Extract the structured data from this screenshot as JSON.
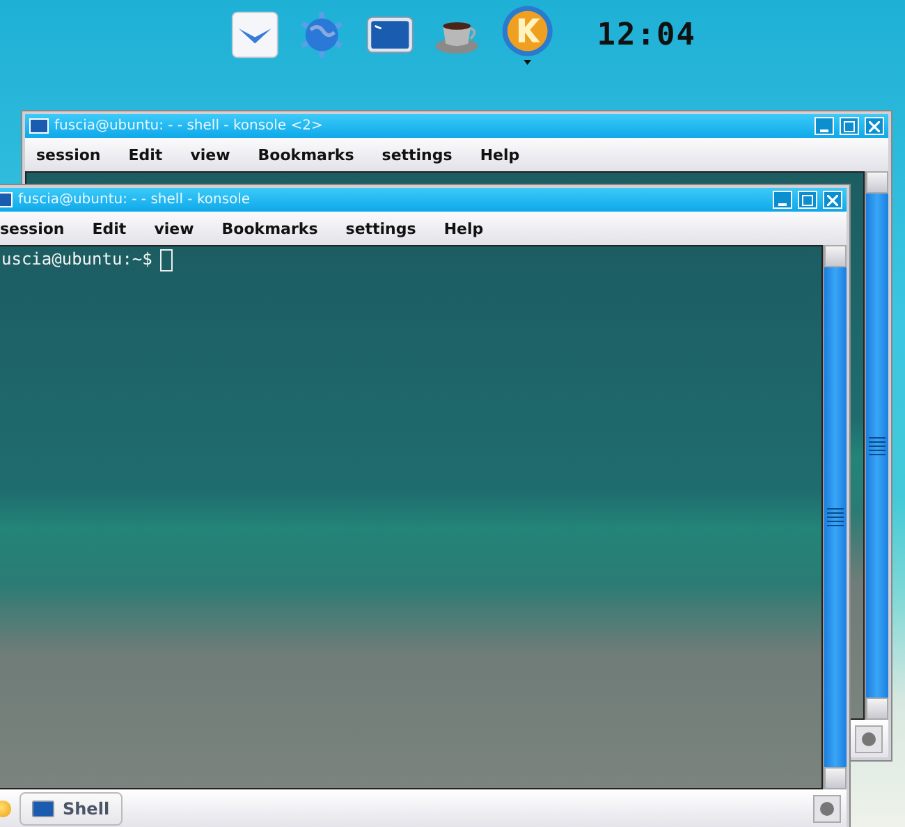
{
  "panel": {
    "launchers": [
      {
        "kind": "mail"
      },
      {
        "kind": "globe"
      },
      {
        "kind": "terminal"
      },
      {
        "kind": "cup"
      },
      {
        "kind": "kmenu"
      }
    ],
    "clock": "12:04"
  },
  "windows": [
    {
      "title": "fuscia@ubuntu: - - shell - konsole <2>",
      "menu": [
        "session",
        "Edit",
        "view",
        "Bookmarks",
        "settings",
        "Help"
      ]
    },
    {
      "title": "fuscia@ubuntu: - - shell - konsole",
      "menu": [
        "session",
        "Edit",
        "view",
        "Bookmarks",
        "settings",
        "Help"
      ],
      "prompt": "uscia@ubuntu:~$",
      "tab": "Shell"
    }
  ]
}
